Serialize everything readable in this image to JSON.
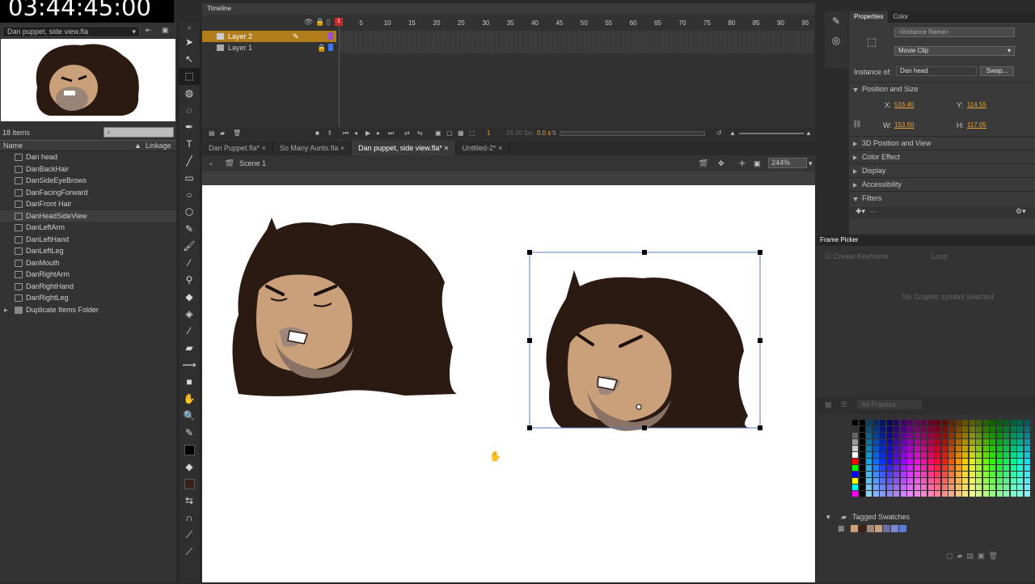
{
  "timer": "03:44:45:00",
  "library": {
    "doc_select": "Dan puppet, side view.fla",
    "item_count": "18 items",
    "search_placeholder": "",
    "col_name": "Name",
    "col_linkage": "Linkage",
    "items": [
      {
        "label": "Dan head"
      },
      {
        "label": "DanBackHair"
      },
      {
        "label": "DanSideEyeBrows"
      },
      {
        "label": "DanFacingForward"
      },
      {
        "label": "DanFront Hair"
      },
      {
        "label": "DanHeadSideView",
        "selected": true
      },
      {
        "label": "DanLeftArm"
      },
      {
        "label": "DanLeftHand"
      },
      {
        "label": "DanLeftLeg"
      },
      {
        "label": "DanMouth"
      },
      {
        "label": "DanRightArm"
      },
      {
        "label": "DanRightHand"
      },
      {
        "label": "DanRightLeg"
      }
    ],
    "folder": "Duplicate Items Folder"
  },
  "timeline": {
    "title": "Timeline",
    "layers": [
      {
        "name": "Layer 2",
        "selected": true
      },
      {
        "name": "Layer 1"
      }
    ],
    "ruler": [
      "1",
      "5",
      "10",
      "15",
      "20",
      "25",
      "30",
      "35",
      "40",
      "45",
      "50",
      "55",
      "60",
      "65",
      "70",
      "75",
      "80",
      "85",
      "90",
      "95"
    ],
    "frame": "1",
    "fps": "24.00 fps",
    "time": "0.0 s"
  },
  "tabs": [
    {
      "label": "Dan Puppet.fla*"
    },
    {
      "label": "So Many Aunts.fla"
    },
    {
      "label": "Dan puppet, side view.fla*",
      "active": true
    },
    {
      "label": "Untitled-2*"
    }
  ],
  "editbar": {
    "scene": "Scene 1",
    "zoom": "244%"
  },
  "properties": {
    "tab_props": "Properties",
    "tab_color": "Color",
    "instance_name_placeholder": "<Instance Name>",
    "type": "Movie Clip",
    "instance_of_label": "Instance of:",
    "instance_of": "Dan head",
    "swap": "Swap...",
    "pos_size": "Position and Size",
    "x_label": "X:",
    "x": "516.40",
    "y_label": "Y:",
    "y": "114.55",
    "w_label": "W:",
    "w": "153.50",
    "h_label": "H:",
    "h": "117.05",
    "sections": [
      "3D Position and View",
      "Color Effect",
      "Display",
      "Accessibility"
    ],
    "filters": "Filters"
  },
  "frame_picker": {
    "title": "Frame Picker",
    "create_keyframe": "Create Keyframe",
    "loop": "Loop",
    "empty_msg": "No Graphic symbol selected",
    "all_frames": "All Frames"
  },
  "swatches": {
    "tagged": "Tagged Swatches"
  }
}
